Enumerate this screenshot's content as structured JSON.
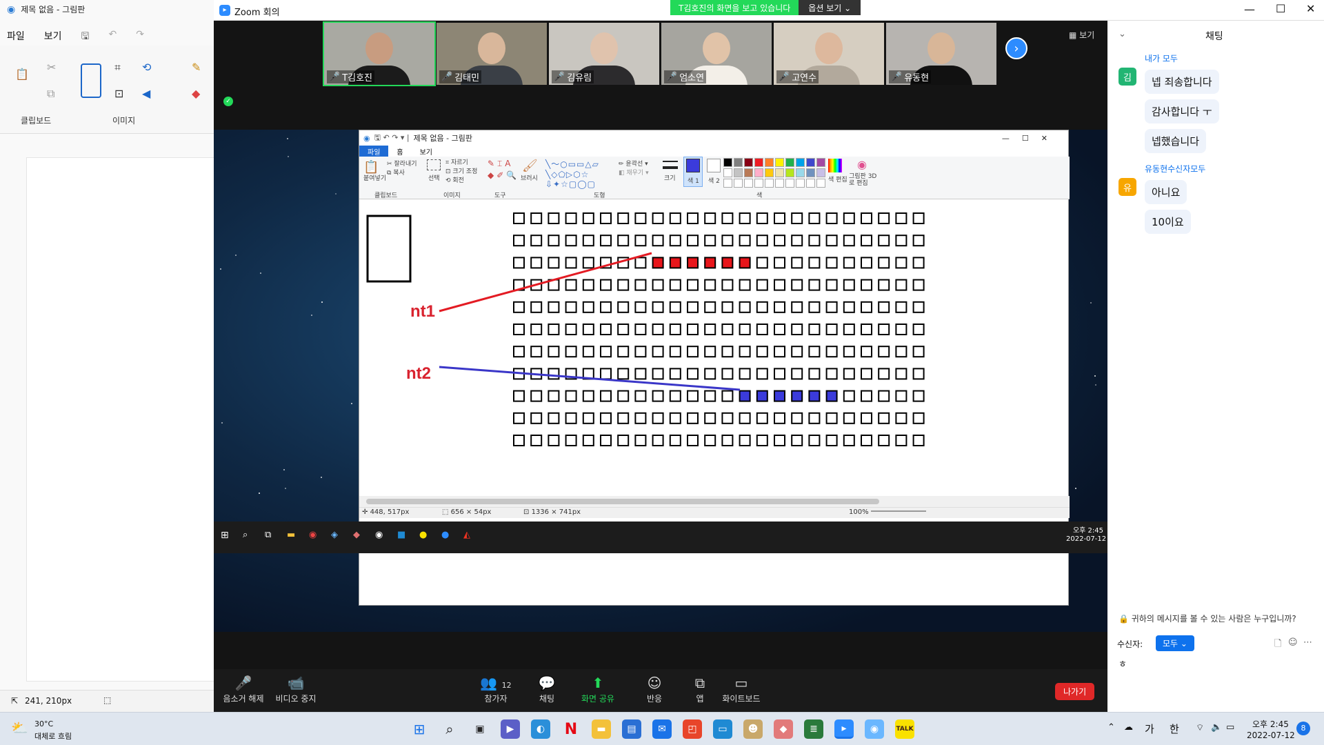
{
  "bg_paint": {
    "title": "제목 없음 - 그림판",
    "menu": [
      "파일",
      "보기"
    ],
    "groups": [
      "클립보드",
      "이미지"
    ],
    "coords": "241, 210px"
  },
  "zoom": {
    "title": "Zoom 회의",
    "share_banner": "T김호진의 화면을 보고 있습니다",
    "view_options": "옵션 보기",
    "view_label": "보기",
    "participants": [
      {
        "name": "T김호진",
        "bg": "#a9a9a2",
        "skin": "#c89c80",
        "shirt": "#1b1b1b"
      },
      {
        "name": "김태민",
        "bg": "#8d8675",
        "skin": "#d9b79b",
        "shirt": "#3a3f46"
      },
      {
        "name": "김유림",
        "bg": "#c9c6c0",
        "skin": "#e0c3ad",
        "shirt": "#2c2b2d"
      },
      {
        "name": "엄소연",
        "bg": "#a6a59f",
        "skin": "#e1c3a8",
        "shirt": "#f3efe8"
      },
      {
        "name": "고연수",
        "bg": "#d6cec1",
        "skin": "#ddb89d",
        "shirt": "#b2a99c"
      },
      {
        "name": "유동현",
        "bg": "#b7b4b0",
        "skin": "#d8b698",
        "shirt": "#111111"
      }
    ],
    "controls": [
      {
        "label": "음소거 해제",
        "icon": "🎤"
      },
      {
        "label": "비디오 중지",
        "icon": "📹"
      },
      {
        "label": "참가자",
        "icon": "👥",
        "count": "12"
      },
      {
        "label": "채팅",
        "icon": "💬"
      },
      {
        "label": "화면 공유",
        "icon": "⬆"
      },
      {
        "label": "반응",
        "icon": "☺"
      },
      {
        "label": "앱",
        "icon": "⧉"
      },
      {
        "label": "화이트보드",
        "icon": "▭"
      }
    ],
    "leave": "나가기"
  },
  "shared_paint": {
    "title": "제목 없음 - 그림판",
    "tabs": [
      "파일",
      "홈",
      "보기"
    ],
    "ribbon_groups": [
      "클립보드",
      "이미지",
      "도구",
      "도형",
      "색"
    ],
    "ribbon_labels": {
      "paste": "붙여넣기",
      "cut": "잘라내기",
      "copy": "복사",
      "select": "선택",
      "crop": "자르기",
      "resize": "크기 조정",
      "rotate": "회전",
      "brush": "브러시",
      "outline": "윤곽선",
      "fill": "채우기",
      "size": "크기",
      "color1": "색 1",
      "color2": "색 2",
      "edit_colors": "색 편집",
      "paint3d": "그림판 3D로 편집"
    },
    "annotations": [
      "nt1",
      "nt2"
    ],
    "status": {
      "pos": "448, 517px",
      "sel": "656 × 54px",
      "size": "1336 × 741px",
      "zoom": "100%"
    },
    "clock_time": "오후 2:45",
    "clock_date": "2022-07-12",
    "red_row": {
      "row": 2,
      "from": 8,
      "to": 13
    },
    "blue_row": {
      "row": 8,
      "from": 13,
      "to": 18
    },
    "colors": {
      "red": "#e8161b",
      "blue": "#3b3bdb"
    }
  },
  "chat": {
    "title": "채팅",
    "sections": [
      {
        "sender": "내가 모두",
        "avatar": "김",
        "avatar_color": "#22b573",
        "messages": [
          "넵 죄송합니다",
          "감사합니다 ㅜ",
          "넵했습니다"
        ]
      },
      {
        "sender": "유동현수신자모두",
        "avatar": "유",
        "avatar_color": "#f7a600",
        "messages": [
          "아니요",
          "10이요"
        ]
      }
    ],
    "who_can_see": "귀하의 메시지를 볼 수 있는 사람은 누구입니까?",
    "to_label": "수신자:",
    "to_value": "모두",
    "input_text": "ㅎ"
  },
  "taskbar": {
    "weather_temp": "30°C",
    "weather_desc": "대체로 흐림",
    "ime1": "가",
    "ime2": "한",
    "time": "오후 2:45",
    "date": "2022-07-12",
    "badge": "8"
  }
}
